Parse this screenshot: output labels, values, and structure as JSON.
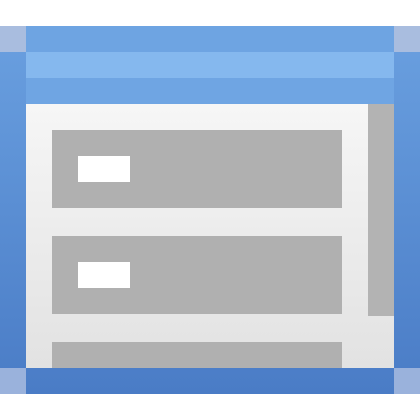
{
  "icon": {
    "name": "window-list-icon",
    "colors": {
      "frame_outer": "#5b8fd6",
      "frame_dark": "#4a7fc9",
      "frame_corner": "#a9bddf",
      "titlebar": "#7fb2ea",
      "titlebar_highlight": "#8dbdf0",
      "content_bg": "#f3f3f3",
      "content_bg_bottom": "#e4e4e4",
      "row_fill": "#b0b0b0",
      "row_label": "#ffffff",
      "scrollbar": "#b3b3b3"
    },
    "rows": [
      {
        "name": "list-row-1"
      },
      {
        "name": "list-row-2"
      },
      {
        "name": "list-row-3"
      }
    ]
  }
}
